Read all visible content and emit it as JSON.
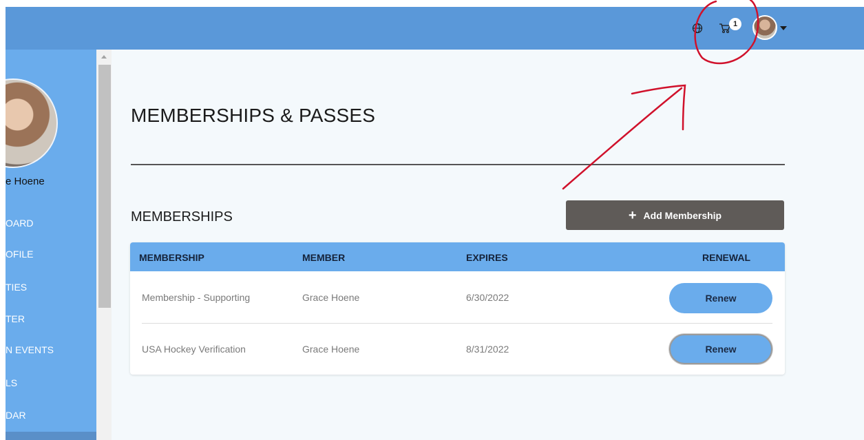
{
  "topbar": {
    "cart_badge": "1",
    "icons": [
      "globe-icon",
      "cart-icon",
      "avatar",
      "caret-down-icon"
    ]
  },
  "sidebar": {
    "user_name": "e Hoene",
    "items": [
      {
        "label": "OARD"
      },
      {
        "label": "OFILE"
      },
      {
        "label": "TIES"
      },
      {
        "label": "TER"
      },
      {
        "label": "N EVENTS"
      },
      {
        "label": "LS"
      },
      {
        "label": "DAR"
      }
    ]
  },
  "main": {
    "page_title": "MEMBERSHIPS & PASSES",
    "section_title": "MEMBERSHIPS",
    "add_button_label": "Add Membership",
    "table": {
      "headers": [
        "MEMBERSHIP",
        "MEMBER",
        "EXPIRES",
        "RENEWAL"
      ],
      "rows": [
        {
          "membership": "Membership - Supporting",
          "member": "Grace Hoene",
          "expires": "6/30/2022",
          "action": "Renew"
        },
        {
          "membership": "USA Hockey Verification",
          "member": "Grace Hoene",
          "expires": "8/31/2022",
          "action": "Renew"
        }
      ]
    }
  },
  "colors": {
    "topbar": "#5a98d9",
    "sidebar": "#6aacec",
    "content_bg": "#f4f9fc",
    "add_button": "#5f5b58",
    "annotation": "#d0112b"
  }
}
